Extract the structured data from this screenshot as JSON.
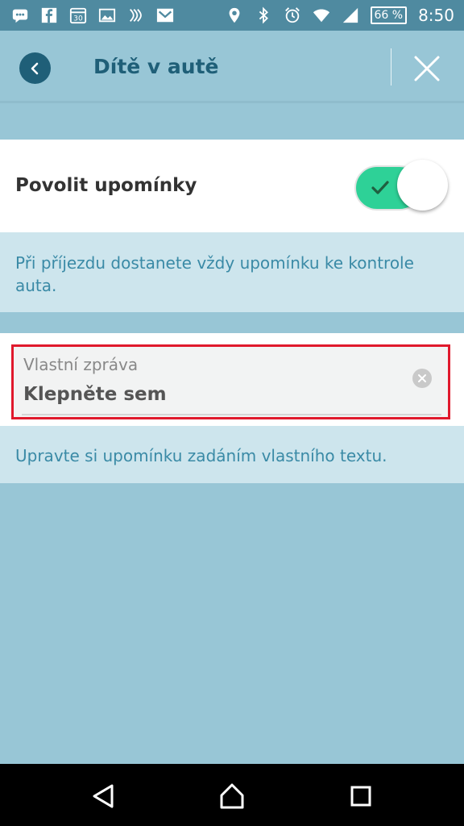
{
  "status_bar": {
    "time": "8:50",
    "battery": "66 %",
    "left_icons": [
      "chat-icon",
      "facebook-icon",
      "calendar-icon",
      "image-icon",
      "nfc-icon",
      "mail-icon"
    ],
    "right_icons": [
      "location-icon",
      "bluetooth-icon",
      "alarm-icon",
      "wifi-icon",
      "signal-icon"
    ],
    "calendar_day": "30"
  },
  "header": {
    "title": "Dítě v autě",
    "back_icon": "back-arrow-icon",
    "close_icon": "close-icon"
  },
  "reminder": {
    "label": "Povolit upomínky",
    "enabled": true,
    "hint": "Při příjezdu dostanete vždy upomínku ke kontrole auta."
  },
  "custom_message": {
    "label": "Vlastní zpráva",
    "value": "Klepněte sem",
    "hint": "Upravte si upomínku zadáním vlastního textu."
  },
  "nav": {
    "icons": [
      "back-triangle-icon",
      "home-icon",
      "recents-icon"
    ]
  },
  "colors": {
    "accent": "#1f5f78",
    "background": "#98c6d6",
    "toggle_on": "#2ed197",
    "highlight": "#e0192c",
    "hint_text": "#3a8aa6"
  }
}
